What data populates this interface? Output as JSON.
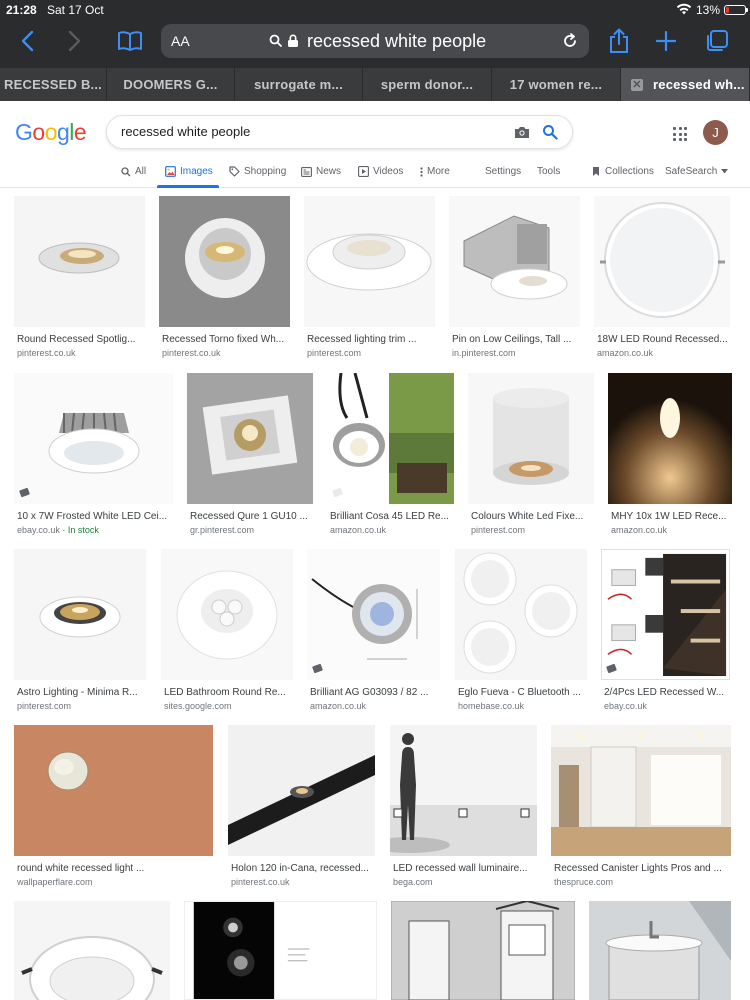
{
  "status_bar": {
    "time": "21:28",
    "date": "Sat 17 Oct",
    "battery": "13%"
  },
  "browser": {
    "text_size_label": "AA",
    "url": "recessed white people",
    "tabs": [
      {
        "label": "RECESSED B..."
      },
      {
        "label": "DOOMERS G..."
      },
      {
        "label": "surrogate m..."
      },
      {
        "label": "sperm donor..."
      },
      {
        "label": "17 women re..."
      },
      {
        "label": "recessed wh..."
      }
    ]
  },
  "google": {
    "logo": "Google",
    "query": "recessed white people",
    "avatar_initial": "J",
    "nav": {
      "all": "All",
      "images": "Images",
      "shopping": "Shopping",
      "news": "News",
      "videos": "Videos",
      "more": "More",
      "settings": "Settings",
      "tools": "Tools",
      "collections": "Collections",
      "safesearch": "SafeSearch"
    }
  },
  "results": [
    {
      "caption": "Round Recessed Spotlig...",
      "source": "pinterest.co.uk"
    },
    {
      "caption": "Recessed Torno fixed Wh...",
      "source": "pinterest.co.uk"
    },
    {
      "caption": "Recessed lighting trim ...",
      "source": "pinterest.com"
    },
    {
      "caption": "Pin on Low Ceilings, Tall ...",
      "source": "in.pinterest.com"
    },
    {
      "caption": "18W LED Round Recessed...",
      "source": "amazon.co.uk"
    },
    {
      "caption": "10 x 7W Frosted White LED Cei...",
      "source": "ebay.co.uk",
      "stock": " · In stock"
    },
    {
      "caption": "Recessed Qure 1 GU10 ...",
      "source": "gr.pinterest.com"
    },
    {
      "caption": "Brilliant Cosa 45 LED Re...",
      "source": "amazon.co.uk"
    },
    {
      "caption": "Colours White Led Fixe...",
      "source": "pinterest.com"
    },
    {
      "caption": "MHY 10x 1W LED Rece...",
      "source": "amazon.co.uk"
    },
    {
      "caption": "Astro Lighting - Minima R...",
      "source": "pinterest.com"
    },
    {
      "caption": "LED Bathroom Round Re...",
      "source": "sites.google.com"
    },
    {
      "caption": "Brilliant AG G03093 / 82 ...",
      "source": "amazon.co.uk"
    },
    {
      "caption": "Eglo Fueva - C Bluetooth ...",
      "source": "homebase.co.uk"
    },
    {
      "caption": "2/4Pcs LED Recessed W...",
      "source": "ebay.co.uk"
    },
    {
      "caption": "round white recessed light ...",
      "source": "wallpaperflare.com"
    },
    {
      "caption": "Holon 120 in-Cana, recessed...",
      "source": "pinterest.co.uk"
    },
    {
      "caption": "LED recessed wall luminaire...",
      "source": "bega.com"
    },
    {
      "caption": "Recessed Canister Lights Pros and ...",
      "source": "thespruce.com"
    }
  ],
  "colors": {
    "chrome": "#2b2c2e",
    "google_blue": "#4285F4",
    "google_red": "#EA4335",
    "google_yellow": "#FBBC05",
    "google_green": "#34A853",
    "link_blue": "#1a73e8"
  }
}
